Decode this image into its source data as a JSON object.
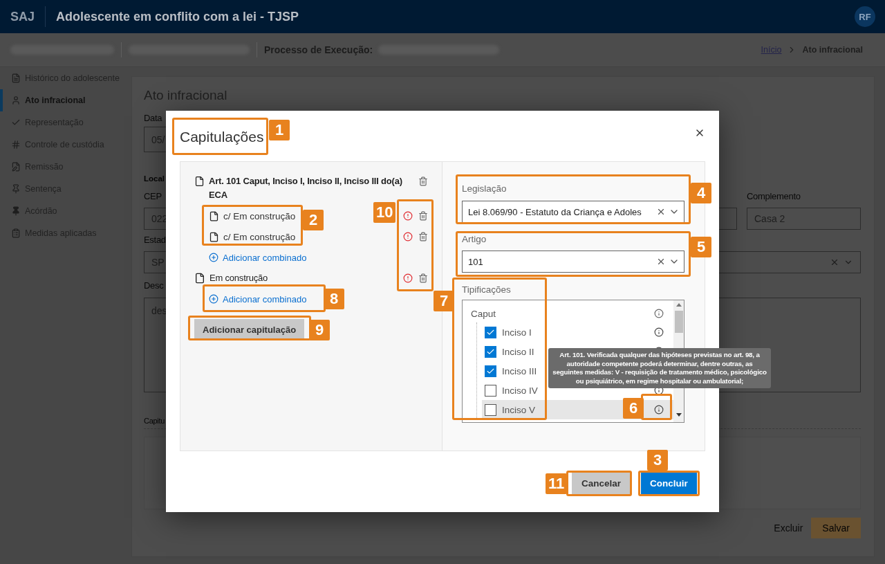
{
  "header": {
    "logo": "SAJ",
    "title": "Adolescente em conflito com a lei - TJSP",
    "avatar": "RF"
  },
  "context_bar": {
    "label": "Processo de Execução:",
    "breadcrumb": [
      {
        "label": "Início",
        "kind": "link"
      },
      {
        "label": "Ato infracional",
        "kind": "current"
      }
    ]
  },
  "sidebar": {
    "items": [
      {
        "label": "Histórico do adolescente",
        "selected": false
      },
      {
        "label": "Ato infracional",
        "selected": true
      },
      {
        "label": "Representação",
        "selected": false
      },
      {
        "label": "Controle de custódia",
        "selected": false
      },
      {
        "label": "Remissão",
        "selected": false
      },
      {
        "label": "Sentença",
        "selected": false
      },
      {
        "label": "Acórdão",
        "selected": false
      },
      {
        "label": "Medidas aplicadas",
        "selected": false
      }
    ]
  },
  "page": {
    "title": "Ato infracional",
    "date_label": "Data",
    "date_value": "05/",
    "local_label": "Local",
    "cep_label": "CEP",
    "cep_value": "022",
    "complemento_label": "Complemento",
    "complemento_value": "Casa 2",
    "estado_label": "Estad",
    "estado_value": "SP",
    "descricao_label": "Desc",
    "descricao_value": "des",
    "capitulacoes_label": "Capitu",
    "buttons": [
      {
        "label": "Excluir",
        "kind": "secondary"
      },
      {
        "label": "Salvar",
        "kind": "primary"
      }
    ]
  },
  "dialog": {
    "title": "Capitulações",
    "capitulations": [
      {
        "title": "Art. 101 Caput, Inciso I, Inciso II, Inciso III do(a) ECA",
        "draft": false,
        "warning": false,
        "combined": [
          {
            "label": "c/ Em construção",
            "warning": true
          },
          {
            "label": "c/ Em construção",
            "warning": true
          }
        ],
        "add_combined": "Adicionar combinado"
      },
      {
        "title": "Em construção",
        "draft": true,
        "warning": true,
        "add_combined": "Adicionar combinado"
      }
    ],
    "add_button": "Adicionar capitulação",
    "legislacao": {
      "label": "Legislação",
      "value": "Lei 8.069/90 - Estatuto da Criança e Adoles"
    },
    "artigo": {
      "label": "Artigo",
      "value": "101"
    },
    "tipificacoes": {
      "label": "Tipificações",
      "tree": [
        {
          "label": "Caput",
          "children": [
            {
              "label": "Inciso I",
              "checked": true,
              "highlighted": false
            },
            {
              "label": "Inciso II",
              "checked": true,
              "highlighted": false
            },
            {
              "label": "Inciso III",
              "checked": true,
              "highlighted": false
            },
            {
              "label": "Inciso IV",
              "checked": false,
              "highlighted": false
            },
            {
              "label": "Inciso V",
              "checked": false,
              "highlighted": true
            }
          ]
        }
      ]
    },
    "tooltip": "Art. 101. Verificada qualquer das hipóteses previstas no art. 98, a autoridade competente poderá determinar, dentre outras, as seguintes medidas: V - requisição de tratamento médico, psicológico ou psiquiátrico, em regime hospitalar ou ambulatorial;",
    "buttons": [
      {
        "label": "Cancelar",
        "kind": "secondary"
      },
      {
        "label": "Concluir",
        "kind": "primary"
      }
    ]
  },
  "callouts": [
    {
      "number": "1"
    },
    {
      "number": "2"
    },
    {
      "number": "3"
    },
    {
      "number": "4"
    },
    {
      "number": "5"
    },
    {
      "number": "6"
    },
    {
      "number": "7"
    },
    {
      "number": "8"
    },
    {
      "number": "9"
    },
    {
      "number": "10"
    },
    {
      "number": "11"
    }
  ]
}
